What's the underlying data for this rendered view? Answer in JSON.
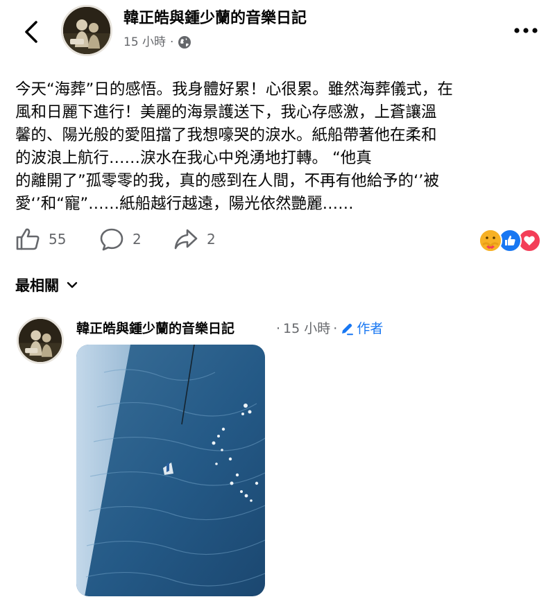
{
  "header": {
    "page_name": "韓正皓與鍾少蘭的音樂日記",
    "time": "15 小時",
    "separator": "·"
  },
  "icons": {
    "back": "chevron-left-icon",
    "privacy": "globe-icon",
    "more": "more-horizontal-icon",
    "like": "thumbs-up-icon",
    "comment": "comment-bubble-icon",
    "share": "share-arrow-icon",
    "edit": "pencil-icon",
    "sort": "chevron-down-icon"
  },
  "post": {
    "lines": [
      "今天“海葬”日的感悟。我身體好累！心很累。雖然海葬儀式，在",
      "風和日麗下進行！美麗的海景護送下，我心存感激，上蒼讓溫",
      "馨的、陽光般的愛阻擋了我想嚎哭的淚水。紙船帶著他在柔和",
      "的波浪上航行……淚水在我心中兇湧地打轉。                        “他真",
      "的離開了”孤零零的我，真的感到在人間，不再有他給予的‘’被",
      "愛‘’和“寵”……紙船越行越遠，陽光依然艷麗……"
    ]
  },
  "actions": {
    "likes": "55",
    "comments": "2",
    "shares": "2"
  },
  "reactions": [
    "care",
    "like",
    "love"
  ],
  "sort": {
    "label": "最相關"
  },
  "comment": {
    "author": "韓正皓與鍾少蘭的音樂日記",
    "dot1": "·",
    "time": "15 小時",
    "dot2": "·",
    "author_badge": "作者"
  },
  "colors": {
    "text": "#050505",
    "secondary": "#65676b",
    "accent": "#1877f2",
    "like_blue": "#1877f2",
    "love_red": "#f33e58",
    "care_yellow": "#f7b125"
  }
}
